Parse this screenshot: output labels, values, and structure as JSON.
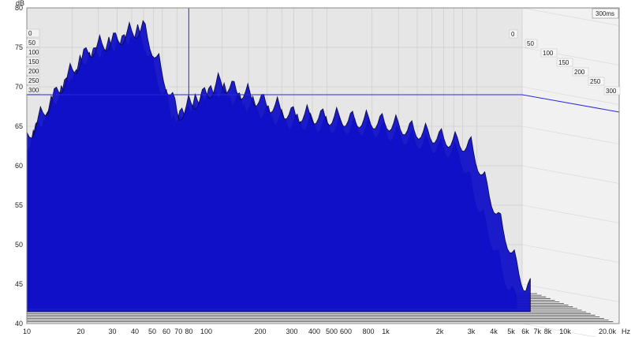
{
  "chart_data": {
    "type": "waterfall-3d",
    "y_unit_label": "dB",
    "x_unit_label": "Hz",
    "time_legend_label": "300ms",
    "ylim": [
      40,
      80
    ],
    "y_ticks": [
      "40",
      "45",
      "50",
      "55",
      "60",
      "65",
      "70",
      "75",
      "80"
    ],
    "xlim_hz": [
      10,
      20000
    ],
    "x_ticks": [
      {
        "hz": 10,
        "label": "10"
      },
      {
        "hz": 20,
        "label": "20"
      },
      {
        "hz": 30,
        "label": "30"
      },
      {
        "hz": 40,
        "label": "40"
      },
      {
        "hz": 50,
        "label": "50"
      },
      {
        "hz": 60,
        "label": "60"
      },
      {
        "hz": 70,
        "label": "70"
      },
      {
        "hz": 80,
        "label": "80"
      },
      {
        "hz": 100,
        "label": "100"
      },
      {
        "hz": 200,
        "label": "200"
      },
      {
        "hz": 300,
        "label": "300"
      },
      {
        "hz": 400,
        "label": "400"
      },
      {
        "hz": 500,
        "label": "500"
      },
      {
        "hz": 600,
        "label": "600"
      },
      {
        "hz": 800,
        "label": "800"
      },
      {
        "hz": 1000,
        "label": "1k"
      },
      {
        "hz": 2000,
        "label": "2k"
      },
      {
        "hz": 3000,
        "label": "3k"
      },
      {
        "hz": 4000,
        "label": "4k"
      },
      {
        "hz": 5000,
        "label": "5k"
      },
      {
        "hz": 6000,
        "label": "6k"
      },
      {
        "hz": 7000,
        "label": "7k"
      },
      {
        "hz": 8000,
        "label": "8k"
      },
      {
        "hz": 10000,
        "label": "10k"
      },
      {
        "hz": 20000,
        "label": "20.0k"
      }
    ],
    "time_slices_ms": [
      "0",
      "50",
      "100",
      "150",
      "200",
      "250",
      "300"
    ],
    "cursor": {
      "hz": 120,
      "db": 69
    },
    "front_slice_peaks": [
      {
        "hz": 10,
        "db": 65
      },
      {
        "hz": 16,
        "db": 72
      },
      {
        "hz": 22,
        "db": 76
      },
      {
        "hz": 45,
        "db": 79
      },
      {
        "hz": 70,
        "db": 68
      },
      {
        "hz": 120,
        "db": 72
      },
      {
        "hz": 300,
        "db": 68
      },
      {
        "hz": 1000,
        "db": 67
      },
      {
        "hz": 3000,
        "db": 64
      },
      {
        "hz": 6000,
        "db": 46
      }
    ],
    "series_color": "#1010e6"
  }
}
